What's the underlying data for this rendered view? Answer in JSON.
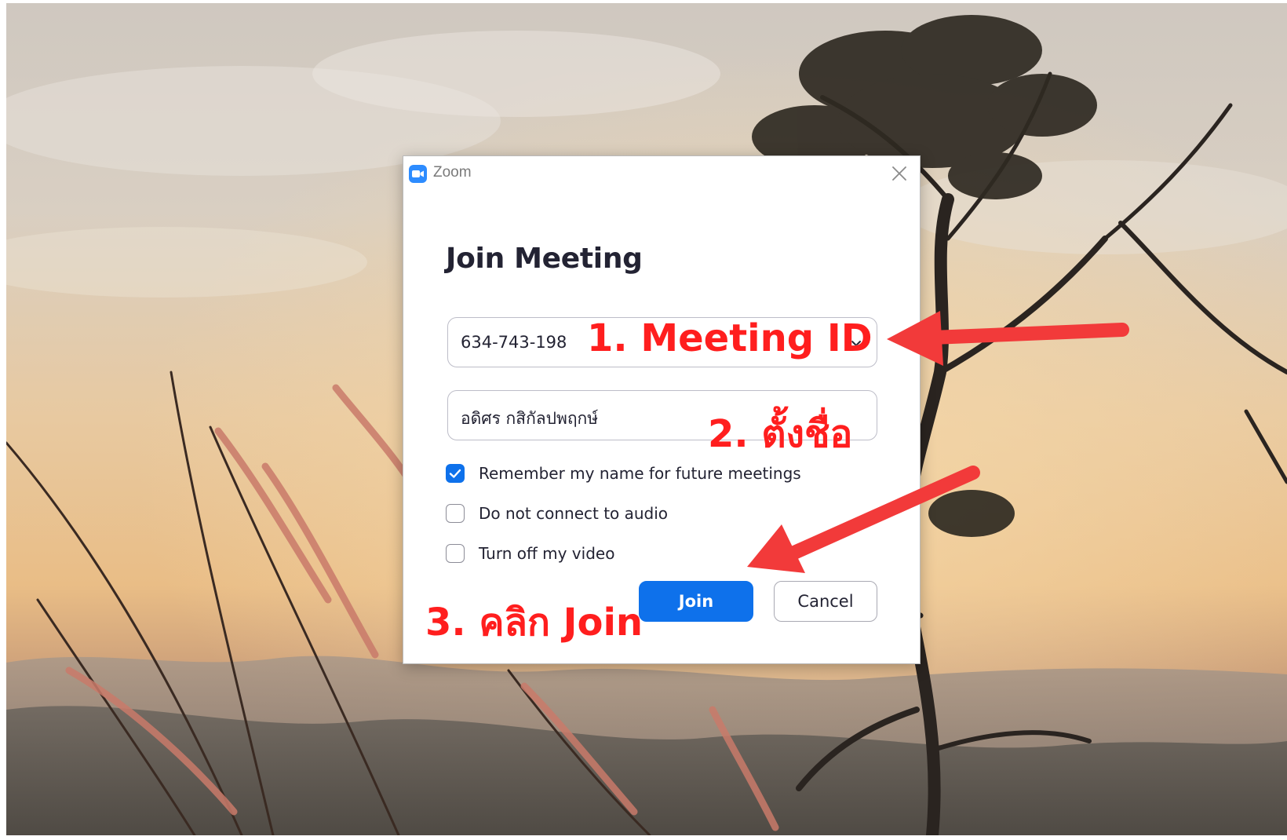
{
  "window": {
    "app_title": "Zoom",
    "heading": "Join Meeting",
    "icons": {
      "app": "zoom-camera-icon",
      "close": "close-icon",
      "dropdown": "chevron-down-icon",
      "check": "checkmark-icon"
    }
  },
  "form": {
    "meeting_id_value": "634-743-198",
    "name_value": "อดิศร  กสิกัลปพฤกษ์",
    "options": [
      {
        "label": "Remember my name for future meetings",
        "checked": true
      },
      {
        "label": "Do not connect to audio",
        "checked": false
      },
      {
        "label": "Turn off my video",
        "checked": false
      }
    ],
    "join_label": "Join",
    "cancel_label": "Cancel"
  },
  "annotations": {
    "step1": "1. Meeting ID",
    "step2": "2. ตั้งชื่อ",
    "step3": "3. คลิก Join"
  },
  "colors": {
    "accent": "#0e71eb",
    "annotation": "#ff1e1e"
  }
}
